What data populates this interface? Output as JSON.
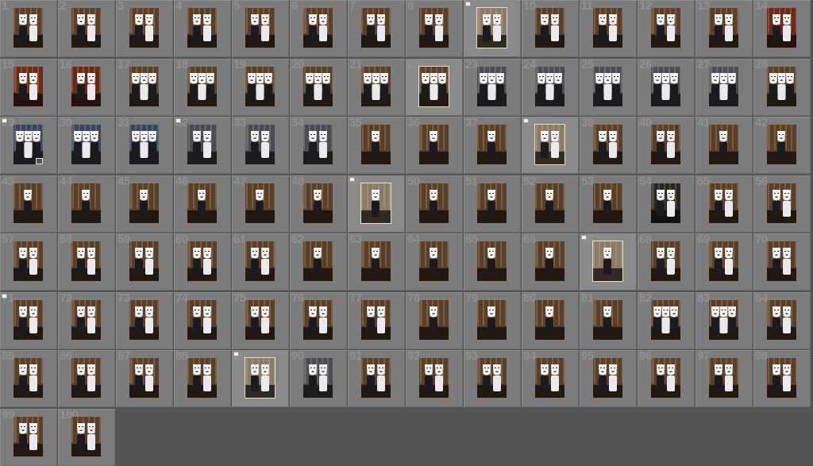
{
  "grid": {
    "total_visible": 100,
    "columns": 14
  },
  "photos": [
    {
      "n": "1",
      "flag": false,
      "tone": "warm",
      "masks": 2
    },
    {
      "n": "2",
      "flag": false,
      "tone": "warm",
      "masks": 2
    },
    {
      "n": "3",
      "flag": false,
      "tone": "warm",
      "masks": 2
    },
    {
      "n": "4",
      "flag": false,
      "tone": "warm",
      "masks": 2
    },
    {
      "n": "5",
      "flag": false,
      "tone": "warm",
      "masks": 2
    },
    {
      "n": "6",
      "flag": false,
      "tone": "warm",
      "masks": 2
    },
    {
      "n": "7",
      "flag": false,
      "tone": "warm",
      "masks": 2
    },
    {
      "n": "8",
      "flag": false,
      "tone": "warm",
      "masks": 2
    },
    {
      "n": "9",
      "flag": true,
      "tone": "light",
      "masks": 2
    },
    {
      "n": "10",
      "flag": false,
      "tone": "warm",
      "masks": 2
    },
    {
      "n": "11",
      "flag": false,
      "tone": "warm",
      "masks": 2
    },
    {
      "n": "12",
      "flag": false,
      "tone": "warm",
      "masks": 2
    },
    {
      "n": "13",
      "flag": false,
      "tone": "warm",
      "masks": 2
    },
    {
      "n": "14",
      "flag": false,
      "tone": "red",
      "masks": 2
    },
    {
      "n": "15",
      "flag": false,
      "tone": "red",
      "masks": 2
    },
    {
      "n": "16",
      "flag": false,
      "tone": "red",
      "masks": 2
    },
    {
      "n": "17",
      "flag": false,
      "tone": "warm",
      "masks": 3
    },
    {
      "n": "18",
      "flag": false,
      "tone": "warm",
      "masks": 3
    },
    {
      "n": "19",
      "flag": false,
      "tone": "warm",
      "masks": 3
    },
    {
      "n": "20",
      "flag": false,
      "tone": "warm",
      "masks": 3
    },
    {
      "n": "21",
      "flag": false,
      "tone": "warm",
      "masks": 3
    },
    {
      "n": "22",
      "flag": false,
      "tone": "warm",
      "masks": 3
    },
    {
      "n": "23",
      "flag": false,
      "tone": "cool",
      "masks": 3
    },
    {
      "n": "24",
      "flag": false,
      "tone": "cool",
      "masks": 3
    },
    {
      "n": "25",
      "flag": false,
      "tone": "cool",
      "masks": 3
    },
    {
      "n": "26",
      "flag": false,
      "tone": "cool",
      "masks": 3
    },
    {
      "n": "27",
      "flag": false,
      "tone": "cool",
      "masks": 3
    },
    {
      "n": "28",
      "flag": false,
      "tone": "warm",
      "masks": 3
    },
    {
      "n": "29",
      "flag": true,
      "tone": "blue",
      "masks": 3
    },
    {
      "n": "30",
      "flag": false,
      "tone": "blue",
      "masks": 3
    },
    {
      "n": "31",
      "flag": false,
      "tone": "blue",
      "masks": 3
    },
    {
      "n": "32",
      "flag": true,
      "tone": "cool",
      "masks": 2
    },
    {
      "n": "33",
      "flag": false,
      "tone": "cool",
      "masks": 2
    },
    {
      "n": "34",
      "flag": false,
      "tone": "cool",
      "masks": 2
    },
    {
      "n": "35",
      "flag": false,
      "tone": "warm",
      "masks": 1
    },
    {
      "n": "36",
      "flag": false,
      "tone": "warm",
      "masks": 1
    },
    {
      "n": "37",
      "flag": false,
      "tone": "warm",
      "masks": 1
    },
    {
      "n": "38",
      "flag": true,
      "tone": "light",
      "masks": 2
    },
    {
      "n": "39",
      "flag": false,
      "tone": "warm",
      "masks": 2
    },
    {
      "n": "40",
      "flag": false,
      "tone": "warm",
      "masks": 2
    },
    {
      "n": "41",
      "flag": false,
      "tone": "warm",
      "masks": 1
    },
    {
      "n": "42",
      "flag": false,
      "tone": "warm",
      "masks": 1
    },
    {
      "n": "43",
      "flag": false,
      "tone": "warm",
      "masks": 1
    },
    {
      "n": "44",
      "flag": false,
      "tone": "warm",
      "masks": 1
    },
    {
      "n": "45",
      "flag": false,
      "tone": "warm",
      "masks": 1
    },
    {
      "n": "46",
      "flag": false,
      "tone": "warm",
      "masks": 1
    },
    {
      "n": "47",
      "flag": false,
      "tone": "warm",
      "masks": 1
    },
    {
      "n": "48",
      "flag": false,
      "tone": "warm",
      "masks": 1
    },
    {
      "n": "49",
      "flag": true,
      "tone": "light",
      "masks": 1
    },
    {
      "n": "50",
      "flag": false,
      "tone": "warm",
      "masks": 1
    },
    {
      "n": "51",
      "flag": false,
      "tone": "warm",
      "masks": 1
    },
    {
      "n": "52",
      "flag": false,
      "tone": "warm",
      "masks": 1
    },
    {
      "n": "53",
      "flag": false,
      "tone": "warm",
      "masks": 1
    },
    {
      "n": "54",
      "flag": false,
      "tone": "dark",
      "masks": 2
    },
    {
      "n": "55",
      "flag": false,
      "tone": "warm",
      "masks": 2
    },
    {
      "n": "56",
      "flag": false,
      "tone": "warm",
      "masks": 2
    },
    {
      "n": "57",
      "flag": false,
      "tone": "warm",
      "masks": 2
    },
    {
      "n": "58",
      "flag": false,
      "tone": "warm",
      "masks": 2
    },
    {
      "n": "59",
      "flag": false,
      "tone": "warm",
      "masks": 2
    },
    {
      "n": "60",
      "flag": false,
      "tone": "warm",
      "masks": 2
    },
    {
      "n": "61",
      "flag": false,
      "tone": "warm",
      "masks": 2
    },
    {
      "n": "62",
      "flag": false,
      "tone": "warm",
      "masks": 1
    },
    {
      "n": "63",
      "flag": false,
      "tone": "warm",
      "masks": 1
    },
    {
      "n": "64",
      "flag": false,
      "tone": "warm",
      "masks": 1
    },
    {
      "n": "65",
      "flag": false,
      "tone": "warm",
      "masks": 1
    },
    {
      "n": "66",
      "flag": false,
      "tone": "warm",
      "masks": 1
    },
    {
      "n": "67",
      "flag": true,
      "tone": "light",
      "masks": 1
    },
    {
      "n": "68",
      "flag": false,
      "tone": "warm",
      "masks": 2
    },
    {
      "n": "69",
      "flag": false,
      "tone": "warm",
      "masks": 2
    },
    {
      "n": "70",
      "flag": false,
      "tone": "warm",
      "masks": 2
    },
    {
      "n": "71",
      "flag": true,
      "tone": "warm",
      "masks": 2
    },
    {
      "n": "72",
      "flag": false,
      "tone": "warm",
      "masks": 2
    },
    {
      "n": "73",
      "flag": false,
      "tone": "warm",
      "masks": 2
    },
    {
      "n": "74",
      "flag": false,
      "tone": "warm",
      "masks": 2
    },
    {
      "n": "75",
      "flag": false,
      "tone": "warm",
      "masks": 2
    },
    {
      "n": "76",
      "flag": false,
      "tone": "warm",
      "masks": 2
    },
    {
      "n": "77",
      "flag": false,
      "tone": "warm",
      "masks": 2
    },
    {
      "n": "78",
      "flag": false,
      "tone": "warm",
      "masks": 1
    },
    {
      "n": "79",
      "flag": false,
      "tone": "warm",
      "masks": 1
    },
    {
      "n": "80",
      "flag": false,
      "tone": "warm",
      "masks": 1
    },
    {
      "n": "81",
      "flag": false,
      "tone": "warm",
      "masks": 1
    },
    {
      "n": "82",
      "flag": false,
      "tone": "warm",
      "masks": 3
    },
    {
      "n": "83",
      "flag": false,
      "tone": "warm",
      "masks": 3
    },
    {
      "n": "84",
      "flag": false,
      "tone": "warm",
      "masks": 2
    },
    {
      "n": "85",
      "flag": false,
      "tone": "warm",
      "masks": 2
    },
    {
      "n": "86",
      "flag": false,
      "tone": "warm",
      "masks": 2
    },
    {
      "n": "87",
      "flag": false,
      "tone": "warm",
      "masks": 2
    },
    {
      "n": "88",
      "flag": false,
      "tone": "warm",
      "masks": 2
    },
    {
      "n": "89",
      "flag": true,
      "tone": "light",
      "masks": 2
    },
    {
      "n": "90",
      "flag": false,
      "tone": "cool",
      "masks": 2
    },
    {
      "n": "91",
      "flag": false,
      "tone": "warm",
      "masks": 2
    },
    {
      "n": "92",
      "flag": false,
      "tone": "warm",
      "masks": 2
    },
    {
      "n": "93",
      "flag": false,
      "tone": "warm",
      "masks": 2
    },
    {
      "n": "94",
      "flag": false,
      "tone": "warm",
      "masks": 2
    },
    {
      "n": "95",
      "flag": false,
      "tone": "warm",
      "masks": 2
    },
    {
      "n": "96",
      "flag": false,
      "tone": "warm",
      "masks": 2
    },
    {
      "n": "97",
      "flag": false,
      "tone": "warm",
      "masks": 2
    },
    {
      "n": "98",
      "flag": false,
      "tone": "warm",
      "masks": 2
    },
    {
      "n": "99",
      "flag": false,
      "tone": "warm",
      "masks": 2
    },
    {
      "n": "100",
      "flag": false,
      "tone": "warm",
      "masks": 2
    }
  ],
  "selected": [
    "9",
    "22",
    "38",
    "49",
    "67",
    "89"
  ],
  "badge_on": [
    "29"
  ],
  "colors": {
    "app_bg": "#545454",
    "cell_bg": "#7c7c7c",
    "number": "#909090",
    "mask": "#f4f4f4",
    "warm": "#5a3f28",
    "red": "#6b2a18",
    "cool": "#4a4c55",
    "blue": "#37465e",
    "light": "#8a7a66",
    "dark": "#2a2520"
  }
}
